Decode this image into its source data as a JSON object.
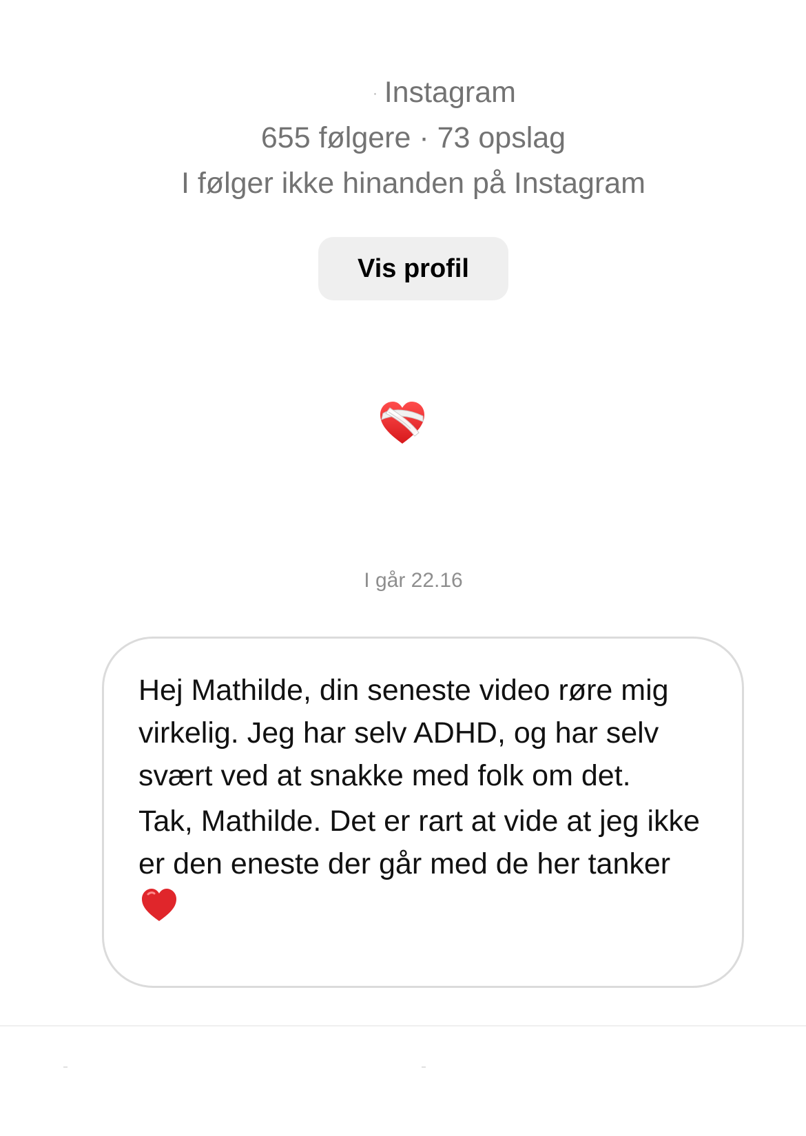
{
  "profile": {
    "username_suffix": "Instagram",
    "stats": "655 følgere · 73 opslag",
    "relationship": "I følger ikke hinanden på Instagram",
    "view_profile_label": "Vis profil"
  },
  "thread": {
    "sticker_icon": "mending-heart-icon",
    "timestamp": "I går 22.16",
    "message": {
      "paragraph_1": "Hej Mathilde, din seneste video røre mig virkelig. Jeg har selv ADHD, og har selv svært ved at snakke med folk om det.",
      "paragraph_2": "Tak, Mathilde. Det er rart at vide at jeg ikke er den eneste der går med de her tanker",
      "trailing_icon": "red-heart-icon"
    }
  },
  "colors": {
    "secondary_text": "#737373",
    "timestamp_text": "#8e8e8e",
    "button_background": "#efefef",
    "bubble_border": "#dbdbdb",
    "heart_red": "#e0262b"
  }
}
